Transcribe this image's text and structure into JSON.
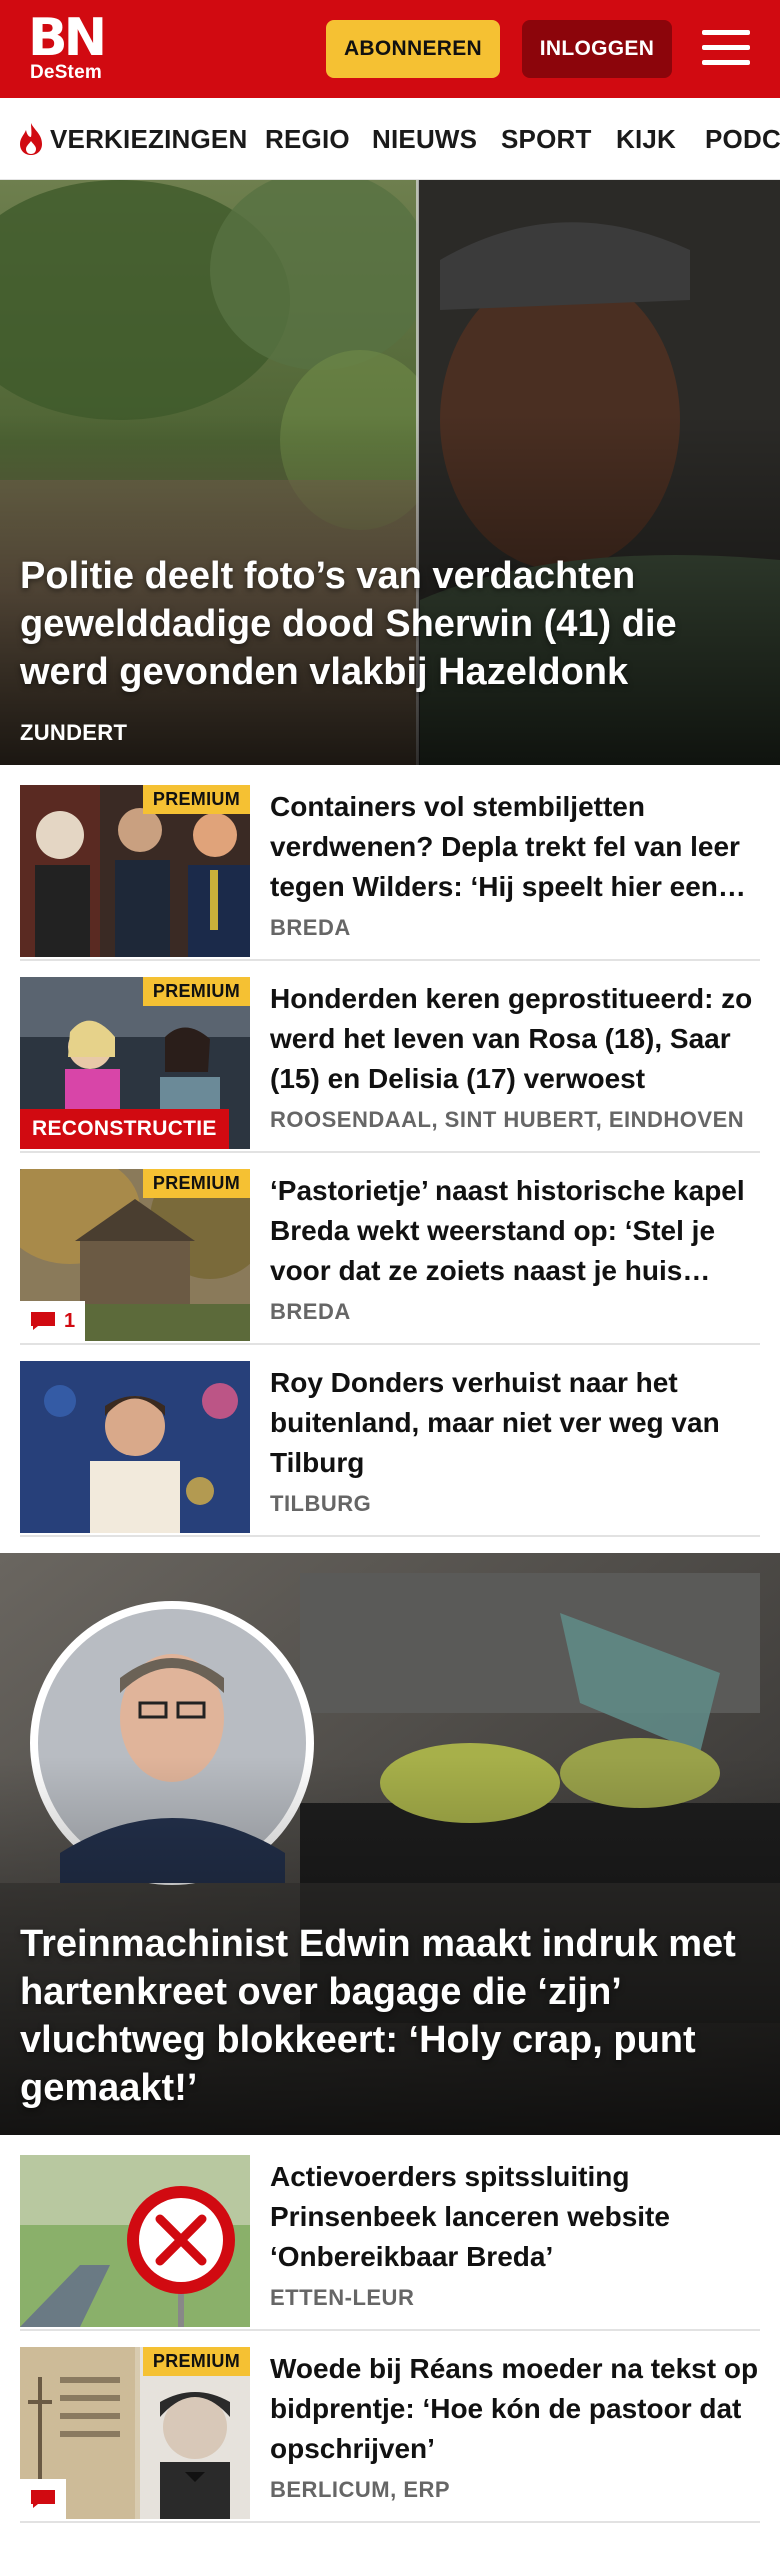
{
  "header": {
    "logo_main": "BN",
    "logo_sub": "DeStem",
    "subscribe_label": "ABONNEREN",
    "login_label": "INLOGGEN"
  },
  "nav": {
    "items": [
      "VERKIEZINGEN",
      "REGIO",
      "NIEUWS",
      "SPORT",
      "KIJK",
      "PODCASTS"
    ]
  },
  "hero": {
    "title": "Politie deelt foto’s van verdachten gewelddadige dood Sherwin (41) die werd gevonden vlakbij Hazeldonk",
    "location": "ZUNDERT"
  },
  "articles": [
    {
      "title": "Containers vol stembiljetten verdwenen? Depla trekt fel van leer tegen Wilders: ‘Hij speelt hier een gevaarlijk spel’",
      "location": "BREDA",
      "badge": "PREMIUM"
    },
    {
      "title": "Honderden keren geprostitueerd: zo werd het leven van Rosa (18), Saar (15) en Delisia (17) verwoest",
      "location": "ROOSENDAAL, SINT HUBERT, EINDHOVEN",
      "badge": "PREMIUM",
      "label": "RECONSTRUCTIE"
    },
    {
      "title": "‘Pastorietje’ naast historische kapel Breda wekt weerstand op: ‘Stel je voor dat ze zoiets naast je huis zetten’",
      "location": "BREDA",
      "badge": "PREMIUM",
      "comments": "1"
    },
    {
      "title": "Roy Donders verhuist naar het buitenland, maar niet ver weg van Tilburg",
      "location": "TILBURG"
    }
  ],
  "feature": {
    "title": "Treinmachinist Edwin maakt indruk met hartenkreet over bagage die ‘zijn’ vluchtweg blokkeert: ‘Holy crap, punt gemaakt!’"
  },
  "articles2": [
    {
      "title": "Actievoerders spitssluiting Prinsenbeek lanceren website ‘Onbereikbaar Breda’",
      "location": "ETTEN-LEUR"
    },
    {
      "title": "Woede bij Réans moeder na tekst op bidprentje: ‘Hoe kón de pastoor dat opschrijven’",
      "location": "BERLICUM, ERP",
      "badge": "PREMIUM"
    }
  ],
  "colors": {
    "brand_red": "#d10a11",
    "premium_yellow": "#f5c133",
    "login_dark_red": "#8c050b"
  },
  "icons": [
    "menu-icon",
    "flame-icon",
    "comment-icon",
    "no-entry-sign-icon"
  ]
}
